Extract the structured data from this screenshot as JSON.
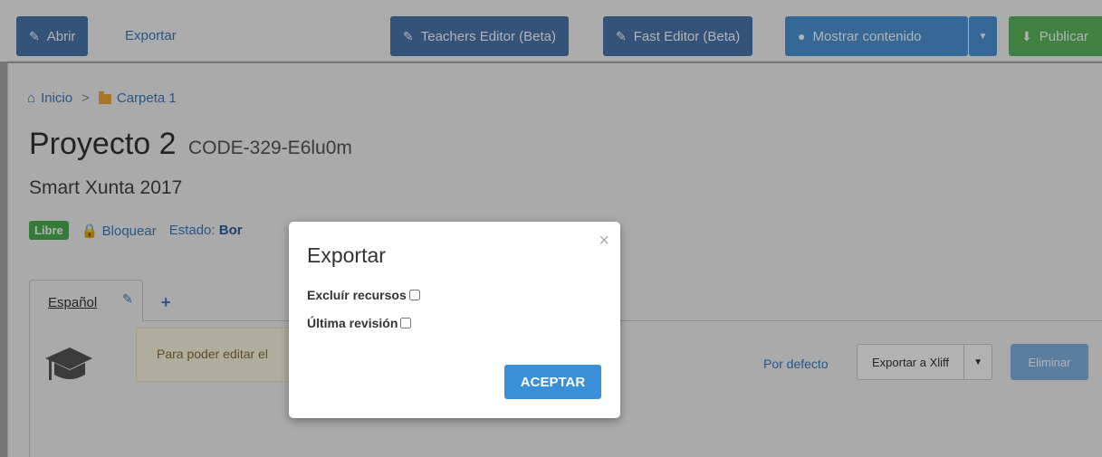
{
  "toolbar": {
    "abrir_label": "Abrir",
    "exportar_label": "Exportar",
    "teachers_editor_label": "Teachers Editor (Beta)",
    "fast_editor_label": "Fast Editor (Beta)",
    "mostrar_contenido_label": "Mostrar contenido",
    "publicar_label": "Publicar"
  },
  "breadcrumb": {
    "home_label": "Inicio",
    "separator": ">",
    "folder_label": "Carpeta 1"
  },
  "project": {
    "title": "Proyecto 2",
    "code": "CODE-329-E6lu0m",
    "subtitle": "Smart Xunta 2017"
  },
  "meta": {
    "badge": "Libre",
    "lock_label": "Bloquear",
    "estado_label": "Estado:",
    "estado_value": "Bor"
  },
  "tabs": {
    "active_label": "Español",
    "add_label": "+"
  },
  "content": {
    "alert_text": "Para poder editar el",
    "por_defecto": "Por defecto",
    "exportar_xliff": "Exportar a Xliff",
    "eliminar": "Eliminar"
  },
  "modal": {
    "title": "Exportar",
    "close": "×",
    "option_excluir": "Excluír recursos",
    "option_ultima": "Última revisión",
    "accept_label": "ACEPTAR"
  },
  "colors": {
    "primary_dark": "#4b77ad",
    "primary": "#4d95d8",
    "success": "#5cb85c",
    "accept": "#3a8fd9"
  }
}
